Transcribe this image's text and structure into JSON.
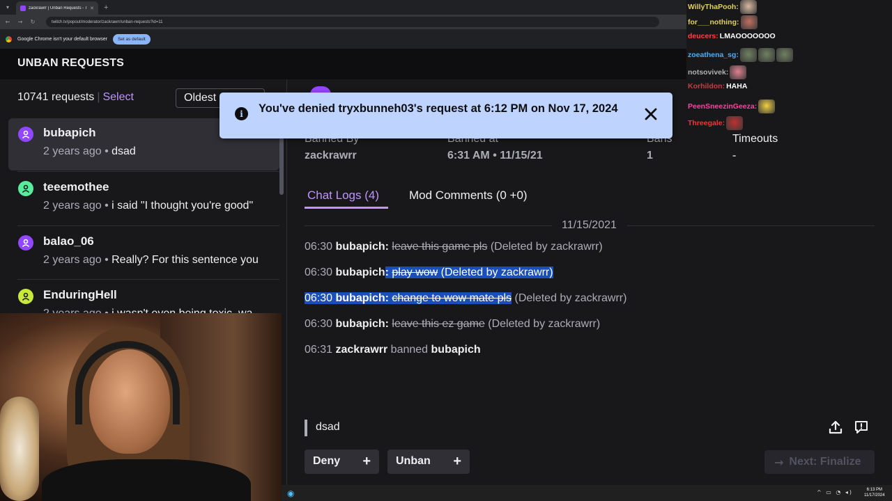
{
  "browser": {
    "tab_title": "zackrawrr | Unban Requests - T",
    "url": "twitch.tv/popout/moderator/zackrawrr/unban-requests?id=11",
    "infobar_text": "Google Chrome isn't your default browser",
    "set_default_label": "Set as default"
  },
  "app": {
    "title": "UNBAN REQUESTS"
  },
  "list": {
    "count": "10741 requests",
    "separator": "|",
    "select_label": "Select",
    "sort_label": "Oldest",
    "items": [
      {
        "name": "bubapich",
        "age": "2 years ago",
        "dot": "•",
        "message": "dsad",
        "avatar_color": "#9147ff"
      },
      {
        "name": "teeemothee",
        "age": "2 years ago",
        "dot": "•",
        "message": "i said \"I thought you're good\"",
        "avatar_color": "#57ed9c"
      },
      {
        "name": "balao_06",
        "age": "2 years ago",
        "dot": "•",
        "message": "Really? For this sentence you",
        "avatar_color": "#9147ff"
      },
      {
        "name": "EnduringHell",
        "age": "2 years ago",
        "dot": "•",
        "message": "i wasn't even being toxic, wa",
        "avatar_color": "#c6e93b"
      }
    ]
  },
  "toast": {
    "message": "You've denied tryxbunneh03's request at 6:12 PM on Nov 17, 2024"
  },
  "detail": {
    "stats": [
      {
        "label": "Banned By",
        "value": "zackrawrr"
      },
      {
        "label": "Banned at",
        "value": "6:31 AM • 11/15/21"
      },
      {
        "label": "Bans",
        "value": "1"
      },
      {
        "label": "Timeouts",
        "value": "-"
      }
    ],
    "tabs": {
      "chat_logs": "Chat Logs (4)",
      "mod_comments": "Mod Comments (0 +0)"
    },
    "date": "11/15/2021",
    "logs": [
      {
        "time": "06:30",
        "user": "bubapich",
        "colon": ":",
        "message": "leave this game pls",
        "note": "(Deleted by zackrawrr)"
      },
      {
        "time": "06:30",
        "user": "bubapich",
        "colon": ":",
        "message": "play wow",
        "note": "(Deleted by zackrawrr)"
      },
      {
        "time": "06:30",
        "user": "bubapich",
        "colon": ":",
        "message": "change to wow mate pls",
        "note": "(Deleted by zackrawrr)"
      },
      {
        "time": "06:30",
        "user": "bubapich",
        "colon": ":",
        "message": "leave this ez game",
        "note": "(Deleted by zackrawrr)"
      }
    ],
    "ban_log": {
      "time": "06:31",
      "actor": "zackrawrr",
      "action": "banned",
      "target": "bubapich"
    },
    "request_text": "dsad",
    "deny_label": "Deny",
    "unban_label": "Unban",
    "next_label": "Next: Finalize"
  },
  "stream_chat": [
    {
      "user": "WillyThaPooh:",
      "color": "#e0d060",
      "message": "",
      "emotes": [
        "#d8b8a0"
      ]
    },
    {
      "user": "for___nothing:",
      "color": "#e0d060",
      "message": "",
      "emotes": [
        "#c07060"
      ]
    },
    {
      "user": "deucers:",
      "color": "#ff4040",
      "message": "LMAOOOOOOO",
      "emotes": []
    },
    {
      "user": "zoeathena_sg:",
      "color": "#40b0ff",
      "message": "",
      "emotes": [
        "#708060",
        "#708060",
        "#708060"
      ]
    },
    {
      "user": "notsovivek:",
      "color": "#b0b0b0",
      "message": "",
      "emotes": [
        "#e08090"
      ]
    },
    {
      "user": "Korhildon:",
      "color": "#c04040",
      "message": "HAHA",
      "emotes": []
    },
    {
      "user": "PeenSneezinGeeza:",
      "color": "#ff40a0",
      "message": "",
      "emotes": [
        "#f0d040"
      ]
    },
    {
      "user": "Threegale:",
      "color": "#ff3030",
      "message": "",
      "emotes": [
        "#c03030"
      ]
    }
  ],
  "taskbar": {
    "time": "6:13 PM",
    "date": "11/17/2024"
  }
}
